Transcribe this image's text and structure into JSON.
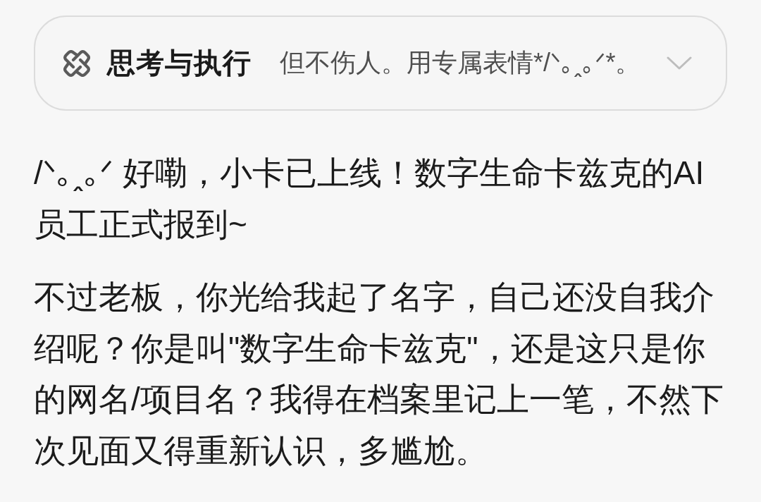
{
  "thinking_panel": {
    "title": "思考与执行",
    "preview": "但不伤人。用专属表情*/ᐠ｡ꞈ｡ᐟ*。",
    "expanded": false
  },
  "message": {
    "paragraphs": [
      "/ᐠ｡ꞈ｡ᐟ 好嘞，小卡已上线！数字生命卡兹克的AI员工正式报到~",
      "不过老板，你光给我起了名字，自己还没自我介绍呢？你是叫\"数字生命卡兹克\"，还是这只是你的网名/项目名？我得在档案里记上一笔，不然下次见面又得重新认识，多尴尬。"
    ]
  }
}
